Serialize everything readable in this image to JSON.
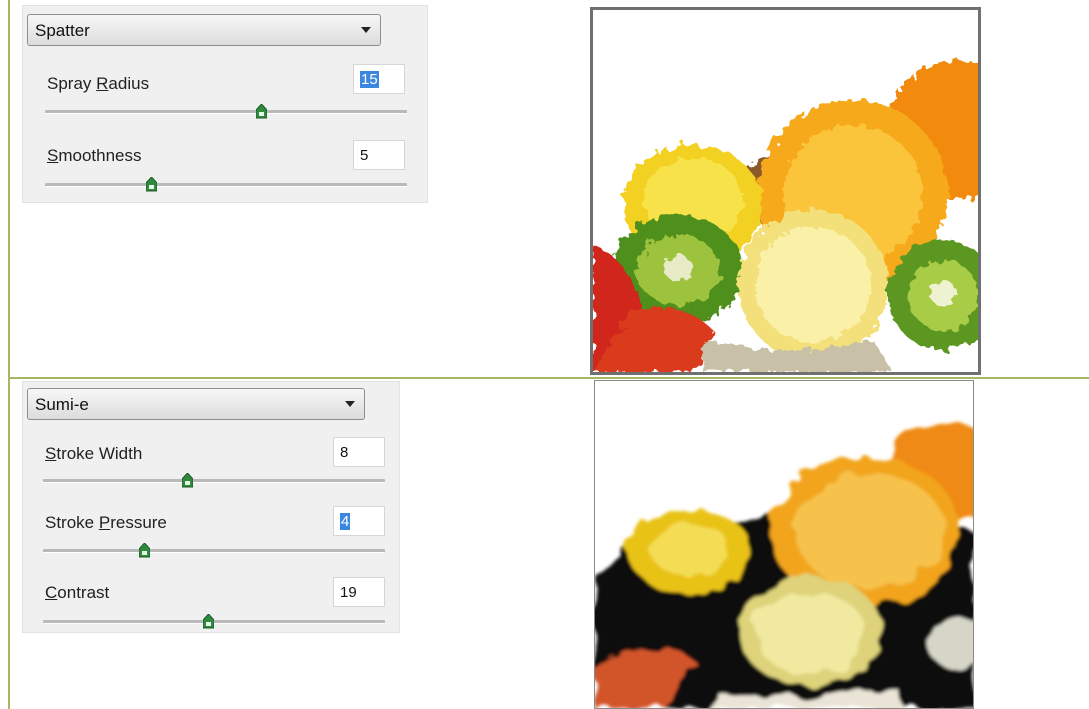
{
  "spatter": {
    "filter_value": "Spatter",
    "params": [
      {
        "label_u": "",
        "label_key": "",
        "label_rest": "Spray ",
        "label_key2": "R",
        "label_tail": "adius",
        "value": "15",
        "level": 0.55,
        "selected": true
      },
      {
        "label_u": "",
        "label_key": "S",
        "label_rest": "",
        "label_key2": "",
        "label_tail": "moothness",
        "value": "5",
        "level": 0.29,
        "selected": false
      }
    ]
  },
  "sumie": {
    "filter_value": "Sumi-e",
    "params": [
      {
        "label_key": "S",
        "label_tail": "troke Width",
        "value": "8",
        "level": 0.41,
        "selected": false
      },
      {
        "label_pre": "Stroke ",
        "label_key": "P",
        "label_tail": "ressure",
        "value": "4",
        "level": 0.24,
        "selected": true
      },
      {
        "label_key": "C",
        "label_tail": "ontrast",
        "value": "19",
        "level": 0.47,
        "selected": false
      }
    ]
  },
  "colors": {
    "table_border": "#a3b860",
    "selection": "#3b86de",
    "thumb_fill": "#2e8b3e"
  }
}
